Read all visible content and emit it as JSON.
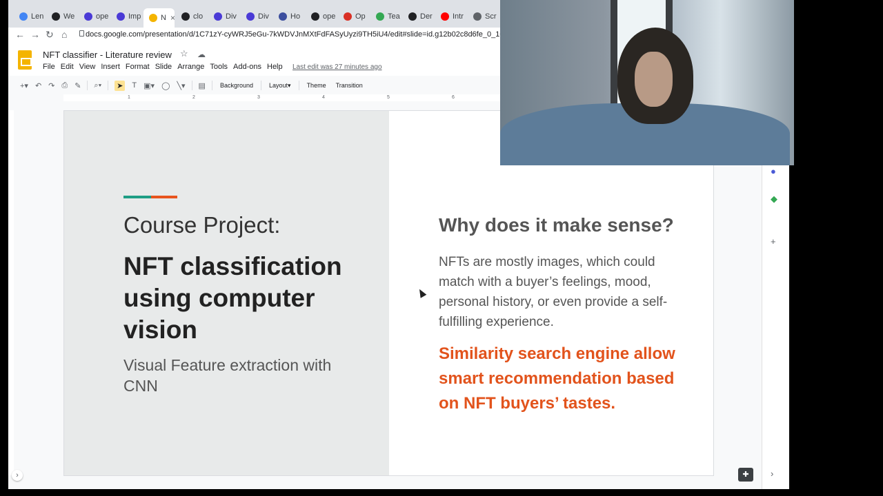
{
  "browser": {
    "tabs": [
      {
        "label": "Len",
        "color": "#4285f4"
      },
      {
        "label": "We",
        "color": "#202124"
      },
      {
        "label": "ope",
        "color": "#4a3ad6"
      },
      {
        "label": "Imp",
        "color": "#4a3ad6"
      },
      {
        "label": "N",
        "color": "#f4b400",
        "active": true
      },
      {
        "label": "clo",
        "color": "#202124"
      },
      {
        "label": "Div",
        "color": "#4a3ad6"
      },
      {
        "label": "Div",
        "color": "#4a3ad6"
      },
      {
        "label": "Ho",
        "color": "#3c4e9e"
      },
      {
        "label": "ope",
        "color": "#202124"
      },
      {
        "label": "Op",
        "color": "#d93025"
      },
      {
        "label": "Tea",
        "color": "#34a853"
      },
      {
        "label": "Der",
        "color": "#202124"
      },
      {
        "label": "Intr",
        "color": "#ff0000"
      },
      {
        "label": "Scr",
        "color": "#5f6368"
      }
    ],
    "url": "docs.google.com/presentation/d/1C71zY-cyWRJ5eGu-7kWDVJnMXtFdFASyUyzi9TH5iU4/edit#slide=id.g12b02c8d6fe_0_108"
  },
  "docs": {
    "title": "NFT classifier - Literature review",
    "menu": [
      "File",
      "Edit",
      "View",
      "Insert",
      "Format",
      "Slide",
      "Arrange",
      "Tools",
      "Add-ons",
      "Help"
    ],
    "last_edit": "Last edit was 27 minutes ago",
    "toolbar": {
      "background": "Background",
      "layout": "Layout",
      "theme": "Theme",
      "transition": "Transition"
    },
    "ruler_numbers": [
      "1",
      "2",
      "3",
      "4",
      "5",
      "6"
    ]
  },
  "slide": {
    "course": "Course Project:",
    "title": "NFT classification using computer vision",
    "subtitle": "Visual Feature extraction with CNN",
    "why": "Why does it make sense?",
    "body": "NFTs are mostly images, which could match with a buyer’s feelings, mood, personal history, or even provide a self-fulfilling experience.",
    "highlight": "Similarity search engine allow smart recommendation based on NFT buyers’ tastes.",
    "colors": {
      "accent_green": "#1e9e85",
      "accent_orange": "#e8541e",
      "highlight": "#e2531c",
      "left_panel": "#e8eaea"
    }
  }
}
